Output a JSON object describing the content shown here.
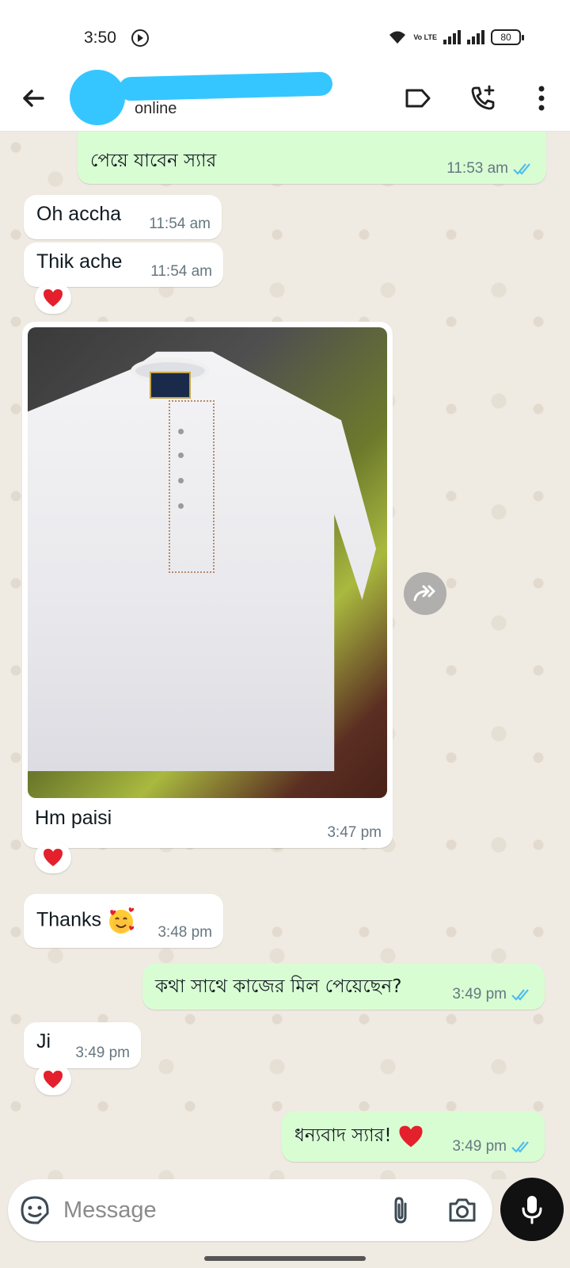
{
  "status_bar": {
    "time": "3:50",
    "network_label": "Vo LTE",
    "battery": "80"
  },
  "header": {
    "presence": "online"
  },
  "messages": [
    {
      "id": "m1",
      "direction": "out",
      "text": "পেয়ে যাবেন স্যার",
      "time": "11:53 am",
      "status": "read"
    },
    {
      "id": "m2",
      "direction": "in",
      "text": "Oh accha",
      "time": "11:54 am"
    },
    {
      "id": "m3",
      "direction": "in",
      "text": "Thik ache",
      "time": "11:54 am",
      "reaction": "heart"
    },
    {
      "id": "m4",
      "direction": "in",
      "type": "image",
      "caption": "Hm paisi",
      "time": "3:47 pm",
      "reaction": "heart",
      "image_label": "RIGHT CHOICE"
    },
    {
      "id": "m5",
      "direction": "in",
      "text": "Thanks",
      "emoji": "smiling-face-with-hearts",
      "time": "3:48 pm"
    },
    {
      "id": "m6",
      "direction": "out",
      "text": "কথা সাথে কাজের মিল পেয়েছেন?",
      "time": "3:49 pm",
      "status": "read"
    },
    {
      "id": "m7",
      "direction": "in",
      "text": "Ji",
      "time": "3:49 pm",
      "reaction": "heart"
    },
    {
      "id": "m8",
      "direction": "out",
      "text": "ধন্যবাদ স্যার!",
      "emoji": "heart",
      "time": "3:49 pm",
      "status": "read"
    }
  ],
  "input": {
    "placeholder": "Message"
  },
  "colors": {
    "incoming_bubble": "#ffffff",
    "outgoing_bubble": "#d9fdd3",
    "read_ticks": "#53bdeb",
    "chat_background": "#efeae2",
    "avatar_redaction": "#36c6ff"
  }
}
